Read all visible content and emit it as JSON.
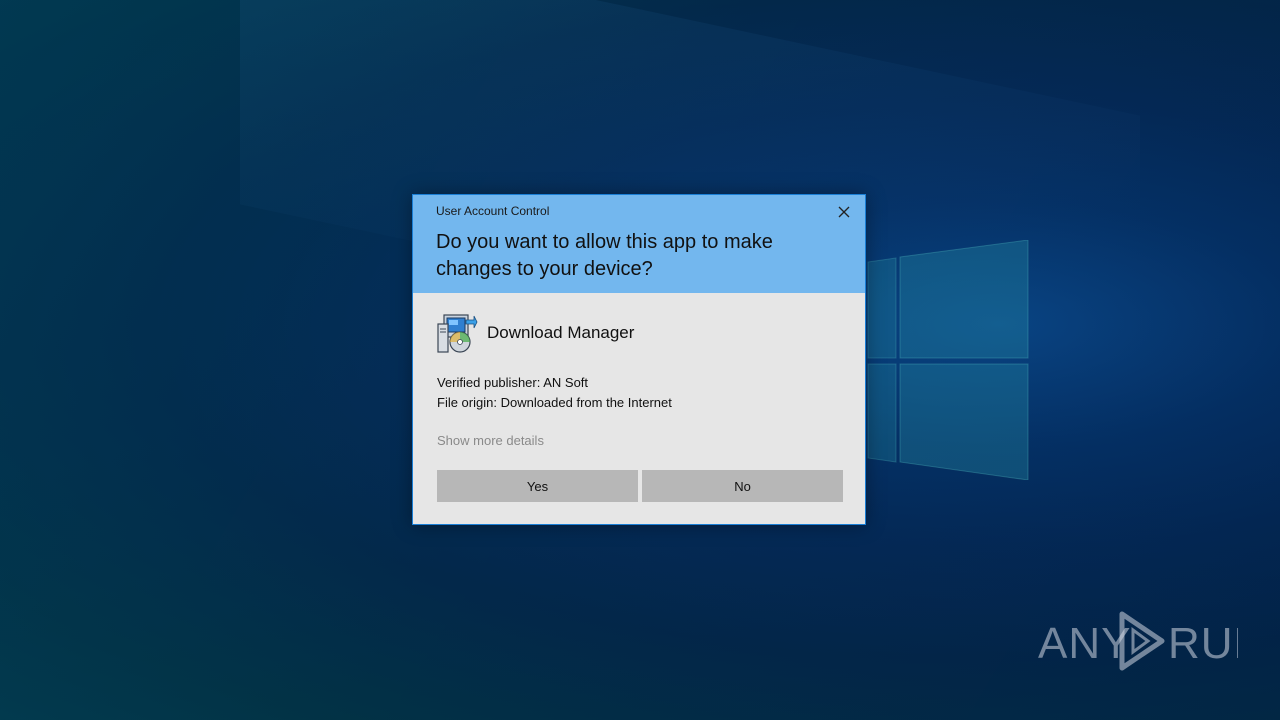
{
  "dialog": {
    "caption": "User Account Control",
    "question": "Do you want to allow this app to make changes to your device?",
    "app_name": "Download Manager",
    "app_icon": "installer-disc-icon",
    "publisher": "Verified publisher: AN Soft",
    "origin": "File origin: Downloaded from the Internet",
    "more_details": "Show more details",
    "yes_label": "Yes",
    "no_label": "No",
    "close_icon": "close-icon"
  },
  "watermark": {
    "text": "ANY RUN",
    "icon": "play-triangle-icon"
  },
  "colors": {
    "header": "#73b7ee",
    "body": "#e6e6e6",
    "button": "#b7b7b7",
    "border": "#1a7fd6",
    "desktop": "#042b58"
  }
}
